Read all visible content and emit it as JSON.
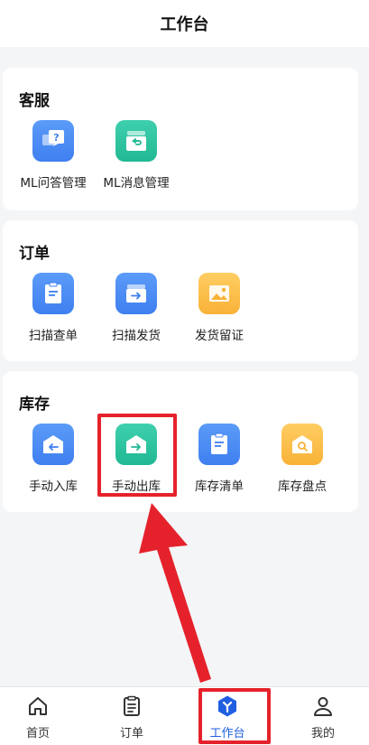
{
  "header": {
    "title": "工作台"
  },
  "sections": [
    {
      "title": "客服",
      "items": [
        {
          "label": "ML问答管理",
          "icon": "qa-chat-icon"
        },
        {
          "label": "ML消息管理",
          "icon": "message-return-icon"
        }
      ]
    },
    {
      "title": "订单",
      "items": [
        {
          "label": "扫描查单",
          "icon": "clipboard-icon"
        },
        {
          "label": "扫描发货",
          "icon": "ship-box-icon"
        },
        {
          "label": "发货留证",
          "icon": "image-icon"
        }
      ]
    },
    {
      "title": "库存",
      "items": [
        {
          "label": "手动入库",
          "icon": "stock-in-icon"
        },
        {
          "label": "手动出库",
          "icon": "stock-out-icon"
        },
        {
          "label": "库存清单",
          "icon": "inventory-list-icon"
        },
        {
          "label": "库存盘点",
          "icon": "inventory-check-icon"
        }
      ]
    }
  ],
  "tabbar": {
    "items": [
      {
        "label": "首页",
        "icon": "home-icon"
      },
      {
        "label": "订单",
        "icon": "order-icon"
      },
      {
        "label": "工作台",
        "icon": "workbench-icon",
        "active": true
      },
      {
        "label": "我的",
        "icon": "profile-icon"
      }
    ]
  },
  "colors": {
    "accent": "#1f5fe0",
    "highlight": "#e5222b",
    "icon_blue": "#4a8af4",
    "icon_green": "#2cc39f",
    "icon_orange": "#fbbd45"
  }
}
